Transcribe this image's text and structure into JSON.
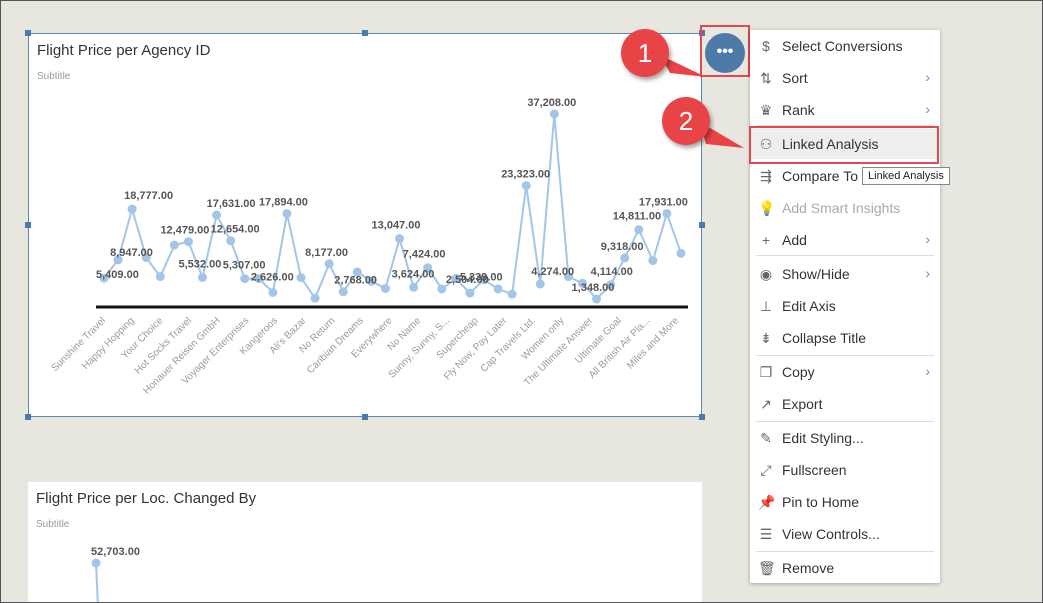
{
  "chart_data": [
    {
      "type": "line",
      "title": "Flight Price per Agency ID",
      "subtitle": "Subtitle",
      "categories": [
        "Sunshine Travel",
        "Happy Hopping",
        "Your Choice",
        "Hot Socks Travel",
        "Honauer Reisen GmbH",
        "Voyager Enterprises",
        "Kangeroos",
        "Ali's Bazar",
        "No Return",
        "Caribian Dreams",
        "Everywhere",
        "No Name",
        "Sunny, Sunny, S...",
        "Supercheap",
        "Fly Now, Pay Later",
        "Cap Travels Ltd.",
        "Women only",
        "The Ultimate Answer",
        "Ultimate Goal",
        "All British Air Pla...",
        "Miles and More"
      ],
      "values": [
        5409,
        8947,
        18777,
        9400,
        5700,
        11800,
        12479,
        5532,
        17631,
        12654,
        5307,
        5309,
        2626,
        17894,
        5500,
        1500,
        8177,
        2768,
        6600,
        4800,
        3400,
        13047,
        3624,
        7424,
        3300,
        5339,
        2504,
        5100,
        3300,
        2300,
        23323,
        4274,
        37208,
        5700,
        4400,
        1348,
        4114,
        9318,
        14811,
        8800,
        17931,
        10200
      ],
      "data_labels": [
        "5,409.00",
        "8,947.00",
        "18,777.00",
        "12,479.00",
        "5,532.00",
        "17,631.00",
        "12,654.00",
        "5,307.00",
        "2,626.00",
        "17,894.00",
        "8,177.00",
        "2,768.00",
        "13,047.00",
        "3,624.00",
        "7,424.00",
        "5,339.00",
        "2,504.00",
        "23,323.00",
        "4,274.00",
        "37,208.00",
        "1,348.00",
        "4,114.00",
        "9,318.00",
        "14,811.00",
        "17,931.00"
      ],
      "series_color": "#a3c6e8"
    },
    {
      "type": "line",
      "title": "Flight Price per Loc. Changed By",
      "subtitle": "Subtitle",
      "data_labels": [
        "52,703.00"
      ],
      "values": [
        52703
      ],
      "series_color": "#a3c6e8"
    }
  ],
  "more_button": {
    "label": "•••"
  },
  "callouts": {
    "one": "1",
    "two": "2"
  },
  "menu": {
    "items": [
      {
        "label": "Select Conversions",
        "icon": "$"
      },
      {
        "label": "Sort",
        "icon": "⇅"
      },
      {
        "label": "Rank",
        "icon": "♛"
      },
      {
        "label": "Linked Analysis",
        "icon": "⚇"
      },
      {
        "label": "Compare To",
        "icon": "⇶"
      },
      {
        "label": "Add Smart Insights",
        "icon": "💡"
      },
      {
        "label": "Add",
        "icon": "+"
      },
      {
        "label": "Show/Hide",
        "icon": "◉"
      },
      {
        "label": "Edit Axis",
        "icon": "⊥"
      },
      {
        "label": "Collapse Title",
        "icon": "⇟"
      },
      {
        "label": "Copy",
        "icon": "❐"
      },
      {
        "label": "Export",
        "icon": "↗"
      },
      {
        "label": "Edit Styling...",
        "icon": "✎"
      },
      {
        "label": "Fullscreen",
        "icon": "⤢"
      },
      {
        "label": "Pin to Home",
        "icon": "📌"
      },
      {
        "label": "View Controls...",
        "icon": "☰"
      },
      {
        "label": "Remove",
        "icon": "🗑"
      }
    ]
  },
  "tooltip": "Linked Analysis"
}
